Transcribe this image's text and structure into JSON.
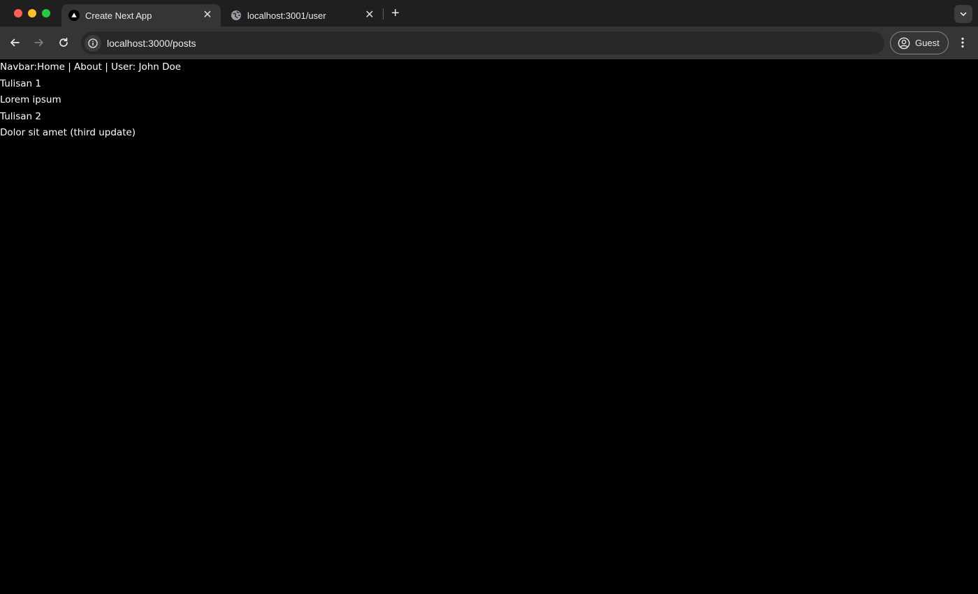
{
  "browser": {
    "tabs": [
      {
        "title": "Create Next App",
        "favicon": "nextjs-triangle-icon",
        "active": true
      },
      {
        "title": "localhost:3001/user",
        "favicon": "globe-icon",
        "active": false
      }
    ],
    "new_tab_label": "+",
    "address": "localhost:3000/posts",
    "profile_label": "Guest"
  },
  "page": {
    "navbar": "Navbar:Home | About | User: John Doe",
    "posts": [
      {
        "title": "Tulisan 1",
        "body": "Lorem ipsum"
      },
      {
        "title": "Tulisan 2",
        "body": "Dolor sit amet (third update)"
      }
    ]
  },
  "colors": {
    "tabstrip_bg": "#1f1f1f",
    "toolbar_bg": "#353535",
    "page_bg": "#000000",
    "page_text": "#ffffff"
  }
}
